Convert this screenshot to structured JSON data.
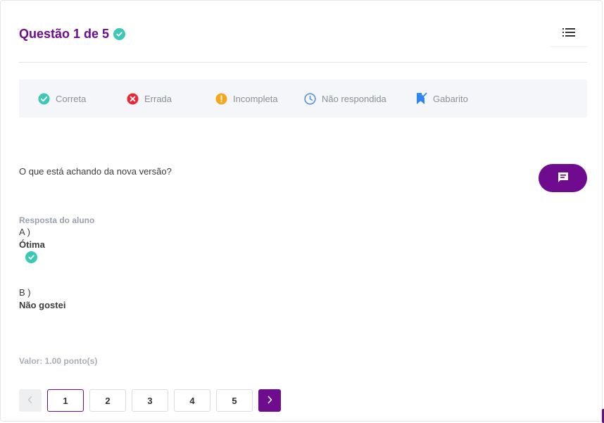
{
  "header": {
    "title": "Questão 1 de 5"
  },
  "legend": {
    "items": [
      {
        "label": "Correta",
        "icon": "check-circle-icon",
        "color": "#3cc8b4"
      },
      {
        "label": "Errada",
        "icon": "x-circle-icon",
        "color": "#e8293b"
      },
      {
        "label": "Incompleta",
        "icon": "exclamation-circle-icon",
        "color": "#f5a61a"
      },
      {
        "label": "Não respondida",
        "icon": "clock-icon",
        "color": "#4a8fe0"
      },
      {
        "label": "Gabarito",
        "icon": "bookmark-check-icon",
        "color": "#2e86f0"
      }
    ]
  },
  "question": {
    "text": "O que está achando da nova versão?"
  },
  "answer": {
    "label": "Resposta do aluno",
    "options": [
      {
        "letter": "A )",
        "text": "Ótima",
        "selected": true
      },
      {
        "letter": "B )",
        "text": "Não gostei",
        "selected": false
      }
    ]
  },
  "value": "Valor: 1.00 ponto(s)",
  "pagination": {
    "pages": [
      "1",
      "2",
      "3",
      "4",
      "5"
    ],
    "current": "1"
  },
  "colors": {
    "brand": "#6e0b8e",
    "correct": "#3cc8b4"
  }
}
